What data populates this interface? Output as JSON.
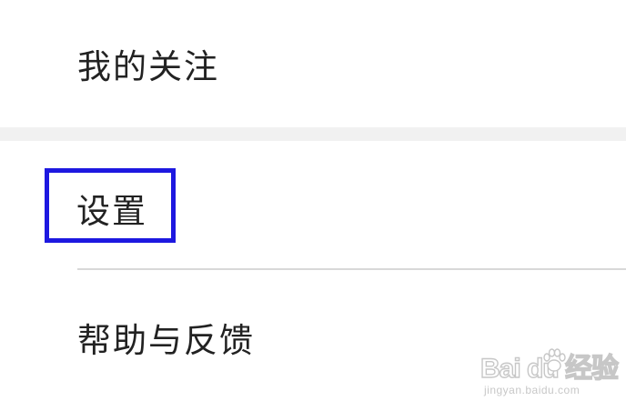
{
  "menu": {
    "following_label": "我的关注",
    "settings_label": "设置",
    "help_label": "帮助与反馈"
  },
  "watermark": {
    "brand_text": "Bai du 经验",
    "url_text": "jingyan.baidu.com"
  },
  "colors": {
    "highlight": "#1d18e0",
    "section_gap": "#f1f1f1",
    "divider": "#d8d8d8",
    "label": "#222222"
  }
}
